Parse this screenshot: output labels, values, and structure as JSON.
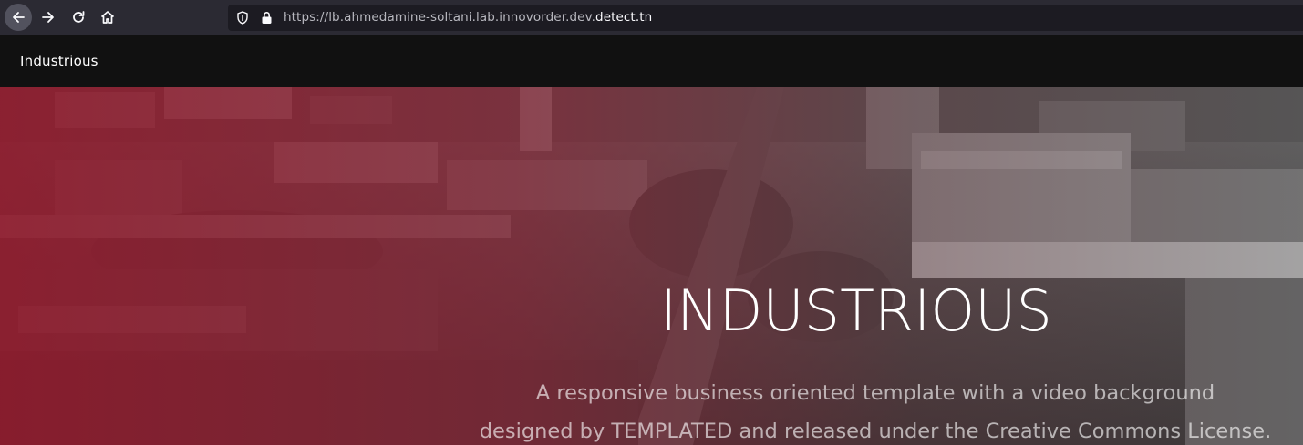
{
  "browser": {
    "url_prefix": "https://lb.ahmedamine-soltani.lab.innovorder.dev.",
    "url_host": "detect.tn",
    "icons": {
      "back": "arrow-left-icon",
      "forward": "arrow-right-icon",
      "reload": "reload-icon",
      "home": "home-icon",
      "shield": "tracking-protection-shield-icon",
      "lock": "padlock-icon"
    }
  },
  "header": {
    "logo": "Industrious"
  },
  "banner": {
    "title": "INDUSTRIOUS",
    "text_line1": "A responsive business oriented template with a video background",
    "text_line2": "designed by TEMPLATED and released under the Creative Commons License.",
    "overlay_color": "#8e1428"
  }
}
